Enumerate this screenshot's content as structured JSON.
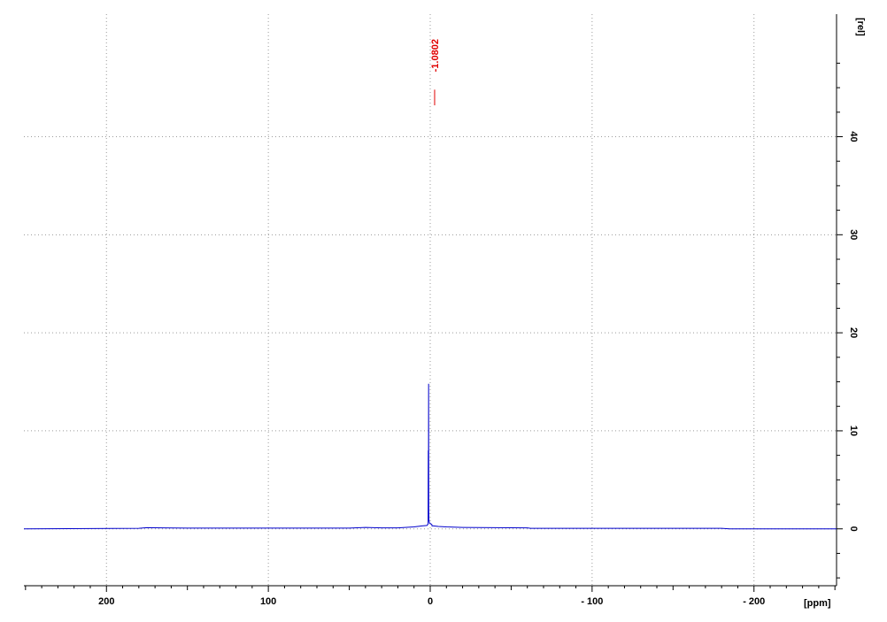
{
  "chart_data": {
    "type": "line",
    "title": "",
    "xlabel": "[ppm]",
    "ylabel": "[rel]",
    "x_reversed": true,
    "xlim": [
      251,
      -251
    ],
    "ylim": [
      -5.8,
      52.5
    ],
    "x_ticks": [
      200,
      100,
      0,
      -100,
      -200
    ],
    "x_tick_labels": [
      "200",
      "100",
      "0",
      "- 100",
      "- 200"
    ],
    "y_ticks": [
      0,
      10,
      20,
      30,
      40
    ],
    "y_tick_labels": [
      "0",
      "10",
      "20",
      "30",
      "40"
    ],
    "grid": true,
    "colors": {
      "spectrum": "#0000cc",
      "peak_label": "#e00000",
      "grid": "#9a9a9a",
      "axis": "#000000"
    },
    "series": [
      {
        "x": [
          251,
          180,
          175,
          165,
          150,
          100,
          50,
          40,
          30,
          20,
          10,
          5,
          2,
          1.3,
          1.2,
          1.1,
          1.0,
          0.9,
          0.8,
          0.5,
          -1,
          -1.1,
          -1.2,
          -2,
          -5,
          -10,
          -20,
          -40,
          -60,
          -62,
          -100,
          -150,
          -180,
          -185,
          -200,
          -251
        ],
        "y": [
          0.0,
          0.05,
          0.12,
          0.1,
          0.08,
          0.08,
          0.08,
          0.15,
          0.1,
          0.1,
          0.2,
          0.3,
          0.35,
          0.5,
          8.0,
          1.5,
          14.8,
          2.0,
          0.9,
          0.6,
          0.45,
          0.3,
          0.3,
          0.3,
          0.25,
          0.2,
          0.15,
          0.12,
          0.1,
          0.05,
          0.05,
          0.05,
          0.05,
          0.0,
          0.0,
          0.0
        ]
      }
    ],
    "peaks": [
      {
        "x": -1.0802,
        "label": "-1.0802"
      }
    ]
  }
}
